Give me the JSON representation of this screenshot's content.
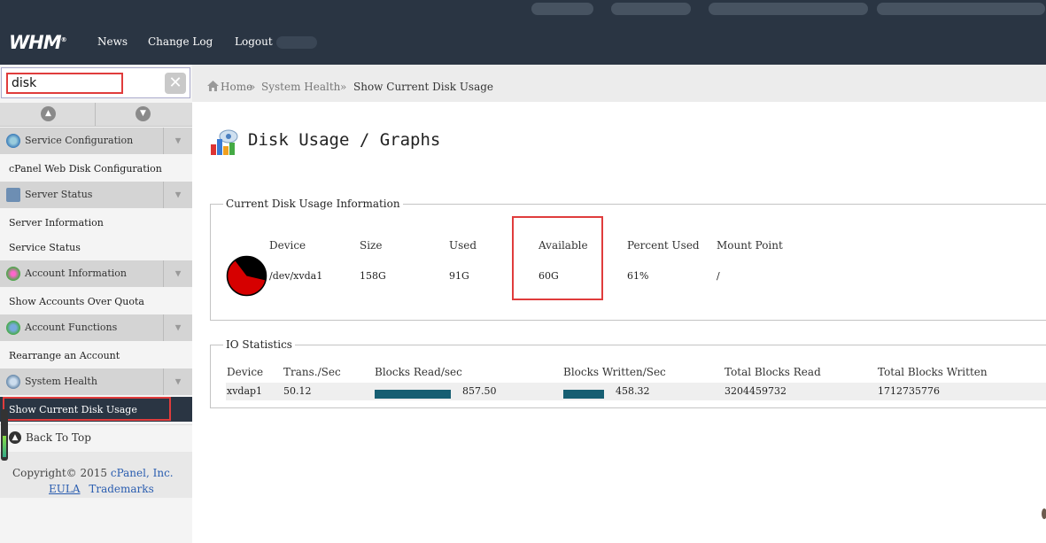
{
  "topbar": {
    "logo": "WHM",
    "nav": [
      "News",
      "Change Log",
      "Logout"
    ]
  },
  "sidebar": {
    "search": {
      "value": "disk",
      "placeholder": ""
    },
    "sections": [
      {
        "label": "Service Configuration",
        "items": [
          "cPanel Web Disk Configuration"
        ]
      },
      {
        "label": "Server Status",
        "items": [
          "Server Information",
          "Service Status"
        ]
      },
      {
        "label": "Account Information",
        "items": [
          "Show Accounts Over Quota"
        ]
      },
      {
        "label": "Account Functions",
        "items": [
          "Rearrange an Account"
        ]
      },
      {
        "label": "System Health",
        "items": [
          "Show Current Disk Usage"
        ]
      }
    ],
    "back_to_top": "Back To Top",
    "copyright": {
      "prefix": "Copyright©",
      "year": "2015",
      "company": "cPanel, Inc.",
      "eula": "EULA",
      "trademarks": "Trademarks"
    }
  },
  "breadcrumb": {
    "home": "Home",
    "sep": "»",
    "parent": "System Health",
    "current": "Show Current Disk Usage"
  },
  "page": {
    "title": "Disk Usage / Graphs"
  },
  "disk_usage": {
    "legend": "Current Disk Usage Information",
    "headers": [
      "Device",
      "Size",
      "Used",
      "Available",
      "Percent Used",
      "Mount Point"
    ],
    "rows": [
      {
        "device": "/dev/xvda1",
        "size": "158G",
        "used": "91G",
        "available": "60G",
        "percent_used": "61%",
        "percent_value": 61,
        "mount": "/"
      }
    ]
  },
  "io_stats": {
    "legend": "IO Statistics",
    "headers": [
      "Device",
      "Trans./Sec",
      "Blocks Read/sec",
      "Blocks Written/Sec",
      "Total Blocks Read",
      "Total Blocks Written"
    ],
    "rows": [
      {
        "device": "xvdap1",
        "trans_per_sec": "50.12",
        "blocks_read_sec": "857.50",
        "blocks_written_sec": "458.32",
        "total_blocks_read": "3204459732",
        "total_blocks_written": "1712735776"
      }
    ]
  },
  "colors": {
    "topbar": "#2a3543",
    "highlight": "#e03c3c",
    "bar": "#165e72",
    "pie_used": "#d60000",
    "pie_free": "#000000"
  }
}
